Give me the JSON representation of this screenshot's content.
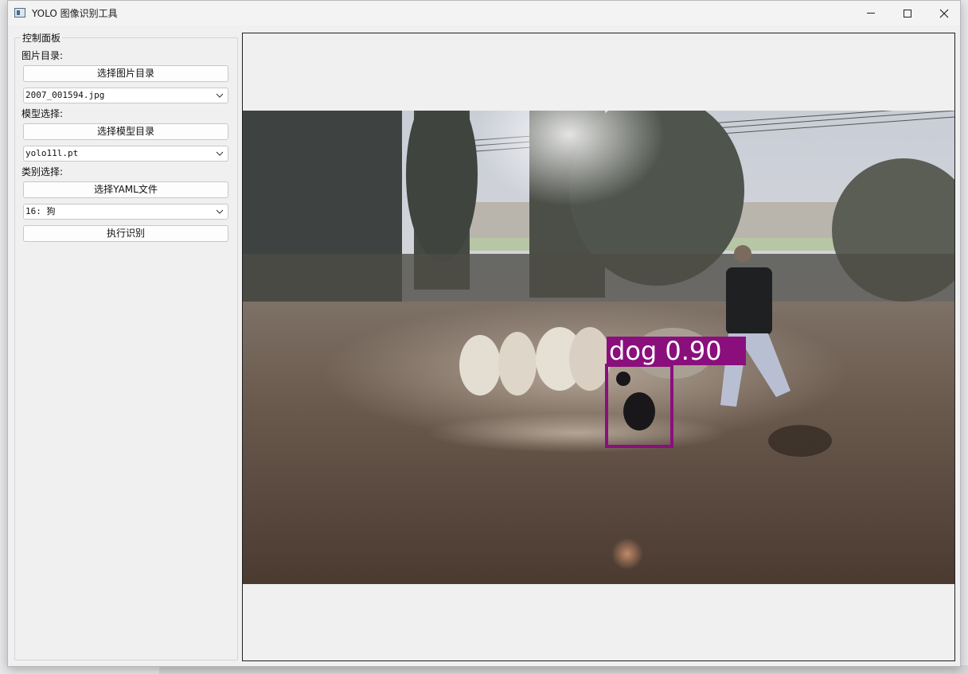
{
  "window": {
    "title": "YOLO 图像识别工具"
  },
  "panel": {
    "group_title": "控制面板",
    "image_dir_label": "图片目录:",
    "select_image_dir_button": "选择图片目录",
    "image_file_selected": "2007_001594.jpg",
    "model_label": "模型选择:",
    "select_model_dir_button": "选择模型目录",
    "model_selected": "yolo11l.pt",
    "class_label": "类别选择:",
    "select_yaml_button": "选择YAML文件",
    "class_selected": "16: 狗",
    "run_button": "执行识别"
  },
  "detection": {
    "label": "dog 0.90",
    "box_color": "#8a0f7d"
  },
  "colors": {
    "window_bg": "#f0f0f0",
    "titlebar_bg": "#f3f3f3"
  }
}
